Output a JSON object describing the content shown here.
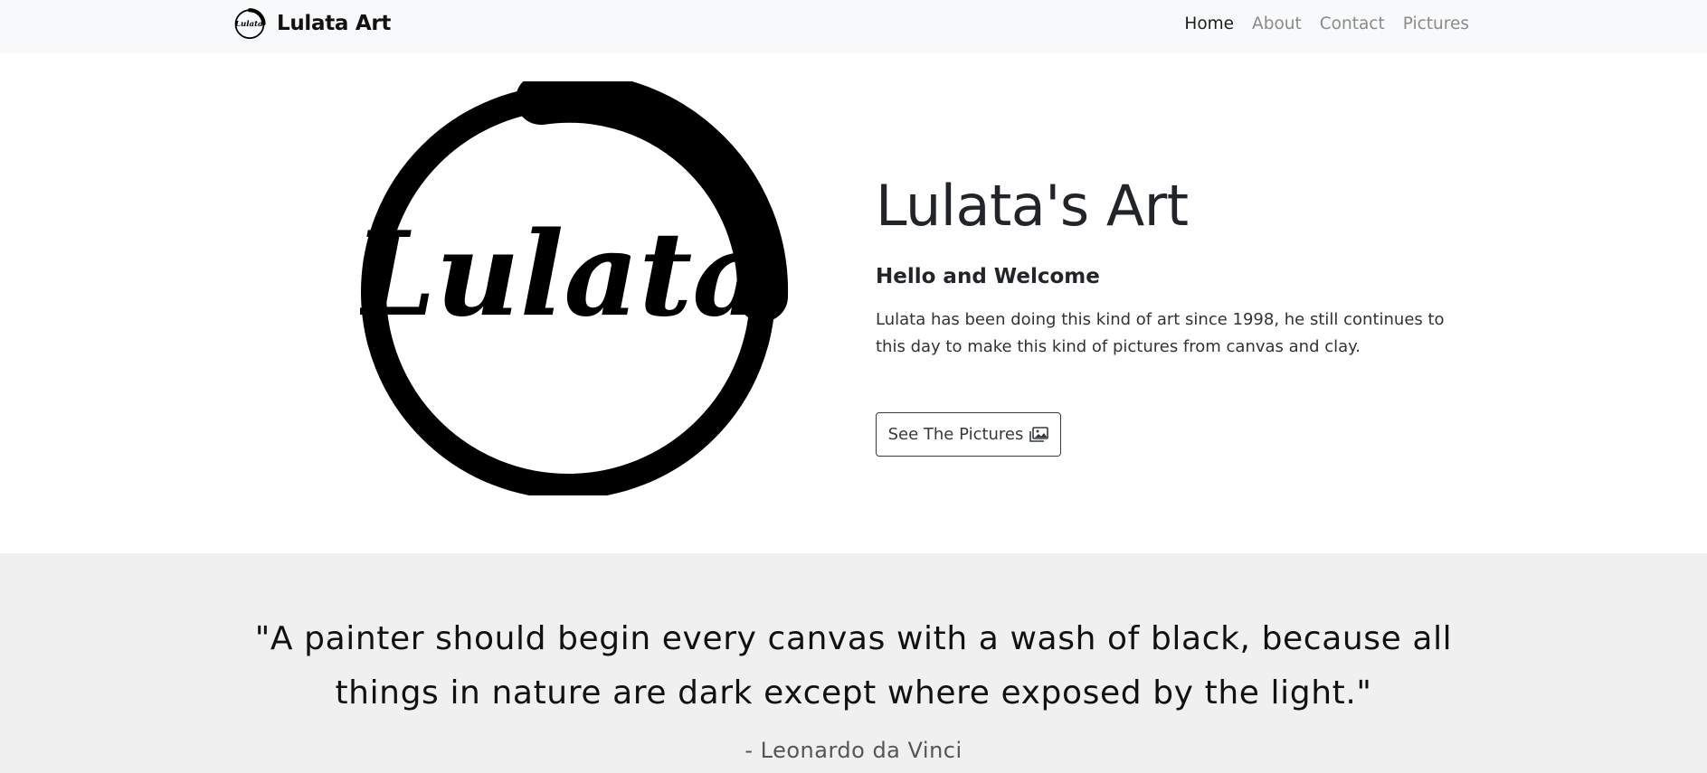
{
  "navbar": {
    "brand_text": "Lulata Art",
    "brand_logo_text": "Lulata",
    "links": [
      {
        "label": "Home",
        "active": true
      },
      {
        "label": "About",
        "active": false
      },
      {
        "label": "Contact",
        "active": false
      },
      {
        "label": "Pictures",
        "active": false
      }
    ]
  },
  "hero": {
    "logo_text": "Lulata",
    "title": "Lulata's Art",
    "subtitle": "Hello and Welcome",
    "description": "Lulata has been doing this kind of art since 1998, he still continues to this day to make this kind of pictures from canvas and clay.",
    "button_label": "See The Pictures",
    "button_icon": "images-icon"
  },
  "quote": {
    "text": "\"A painter should begin every canvas with a wash of black, because all things in nature are dark except where exposed by the light.\"",
    "author": "- Leonardo da Vinci"
  },
  "colors": {
    "navbar_bg": "#f8f9fa",
    "quote_bg": "#f0f0f0",
    "text_dark": "#212529",
    "nav_inactive": "#8a8a8a"
  }
}
